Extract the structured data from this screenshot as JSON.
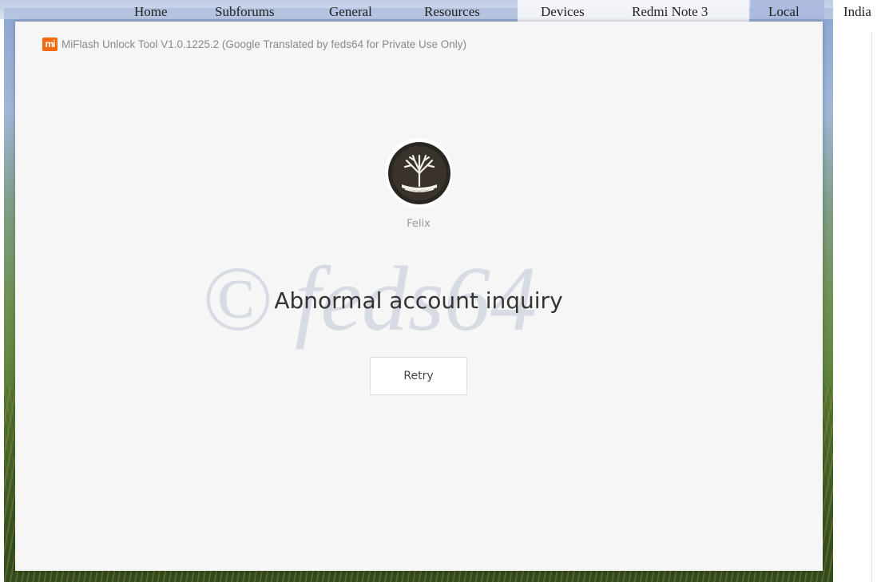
{
  "nav": {
    "items": [
      "Home",
      "Subforums",
      "General",
      "Resources",
      "Devices",
      "Redmi Note 3",
      "Local",
      "India"
    ]
  },
  "app": {
    "logo_text": "mi",
    "title": "MiFlash Unlock Tool V1.0.1225.2 (Google Translated by feds64 for Private Use Only)",
    "watermark": "© feds64",
    "account": {
      "username": "Felix",
      "avatar_icon": "tree-logo-icon"
    },
    "message": "Abnormal account inquiry",
    "retry_label": "Retry"
  },
  "colors": {
    "brand": "#f46a0e",
    "dialog_bg": "#f6f6f6"
  }
}
